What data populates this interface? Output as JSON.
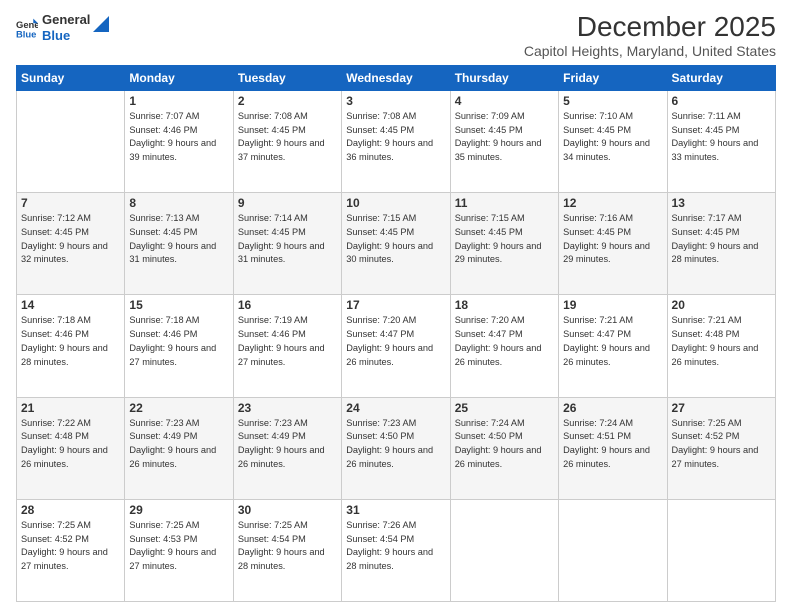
{
  "logo": {
    "line1": "General",
    "line2": "Blue"
  },
  "title": "December 2025",
  "subtitle": "Capitol Heights, Maryland, United States",
  "days_header": [
    "Sunday",
    "Monday",
    "Tuesday",
    "Wednesday",
    "Thursday",
    "Friday",
    "Saturday"
  ],
  "weeks": [
    [
      {
        "num": "",
        "sunrise": "",
        "sunset": "",
        "daylight": ""
      },
      {
        "num": "1",
        "sunrise": "Sunrise: 7:07 AM",
        "sunset": "Sunset: 4:46 PM",
        "daylight": "Daylight: 9 hours and 39 minutes."
      },
      {
        "num": "2",
        "sunrise": "Sunrise: 7:08 AM",
        "sunset": "Sunset: 4:45 PM",
        "daylight": "Daylight: 9 hours and 37 minutes."
      },
      {
        "num": "3",
        "sunrise": "Sunrise: 7:08 AM",
        "sunset": "Sunset: 4:45 PM",
        "daylight": "Daylight: 9 hours and 36 minutes."
      },
      {
        "num": "4",
        "sunrise": "Sunrise: 7:09 AM",
        "sunset": "Sunset: 4:45 PM",
        "daylight": "Daylight: 9 hours and 35 minutes."
      },
      {
        "num": "5",
        "sunrise": "Sunrise: 7:10 AM",
        "sunset": "Sunset: 4:45 PM",
        "daylight": "Daylight: 9 hours and 34 minutes."
      },
      {
        "num": "6",
        "sunrise": "Sunrise: 7:11 AM",
        "sunset": "Sunset: 4:45 PM",
        "daylight": "Daylight: 9 hours and 33 minutes."
      }
    ],
    [
      {
        "num": "7",
        "sunrise": "Sunrise: 7:12 AM",
        "sunset": "Sunset: 4:45 PM",
        "daylight": "Daylight: 9 hours and 32 minutes."
      },
      {
        "num": "8",
        "sunrise": "Sunrise: 7:13 AM",
        "sunset": "Sunset: 4:45 PM",
        "daylight": "Daylight: 9 hours and 31 minutes."
      },
      {
        "num": "9",
        "sunrise": "Sunrise: 7:14 AM",
        "sunset": "Sunset: 4:45 PM",
        "daylight": "Daylight: 9 hours and 31 minutes."
      },
      {
        "num": "10",
        "sunrise": "Sunrise: 7:15 AM",
        "sunset": "Sunset: 4:45 PM",
        "daylight": "Daylight: 9 hours and 30 minutes."
      },
      {
        "num": "11",
        "sunrise": "Sunrise: 7:15 AM",
        "sunset": "Sunset: 4:45 PM",
        "daylight": "Daylight: 9 hours and 29 minutes."
      },
      {
        "num": "12",
        "sunrise": "Sunrise: 7:16 AM",
        "sunset": "Sunset: 4:45 PM",
        "daylight": "Daylight: 9 hours and 29 minutes."
      },
      {
        "num": "13",
        "sunrise": "Sunrise: 7:17 AM",
        "sunset": "Sunset: 4:45 PM",
        "daylight": "Daylight: 9 hours and 28 minutes."
      }
    ],
    [
      {
        "num": "14",
        "sunrise": "Sunrise: 7:18 AM",
        "sunset": "Sunset: 4:46 PM",
        "daylight": "Daylight: 9 hours and 28 minutes."
      },
      {
        "num": "15",
        "sunrise": "Sunrise: 7:18 AM",
        "sunset": "Sunset: 4:46 PM",
        "daylight": "Daylight: 9 hours and 27 minutes."
      },
      {
        "num": "16",
        "sunrise": "Sunrise: 7:19 AM",
        "sunset": "Sunset: 4:46 PM",
        "daylight": "Daylight: 9 hours and 27 minutes."
      },
      {
        "num": "17",
        "sunrise": "Sunrise: 7:20 AM",
        "sunset": "Sunset: 4:47 PM",
        "daylight": "Daylight: 9 hours and 26 minutes."
      },
      {
        "num": "18",
        "sunrise": "Sunrise: 7:20 AM",
        "sunset": "Sunset: 4:47 PM",
        "daylight": "Daylight: 9 hours and 26 minutes."
      },
      {
        "num": "19",
        "sunrise": "Sunrise: 7:21 AM",
        "sunset": "Sunset: 4:47 PM",
        "daylight": "Daylight: 9 hours and 26 minutes."
      },
      {
        "num": "20",
        "sunrise": "Sunrise: 7:21 AM",
        "sunset": "Sunset: 4:48 PM",
        "daylight": "Daylight: 9 hours and 26 minutes."
      }
    ],
    [
      {
        "num": "21",
        "sunrise": "Sunrise: 7:22 AM",
        "sunset": "Sunset: 4:48 PM",
        "daylight": "Daylight: 9 hours and 26 minutes."
      },
      {
        "num": "22",
        "sunrise": "Sunrise: 7:23 AM",
        "sunset": "Sunset: 4:49 PM",
        "daylight": "Daylight: 9 hours and 26 minutes."
      },
      {
        "num": "23",
        "sunrise": "Sunrise: 7:23 AM",
        "sunset": "Sunset: 4:49 PM",
        "daylight": "Daylight: 9 hours and 26 minutes."
      },
      {
        "num": "24",
        "sunrise": "Sunrise: 7:23 AM",
        "sunset": "Sunset: 4:50 PM",
        "daylight": "Daylight: 9 hours and 26 minutes."
      },
      {
        "num": "25",
        "sunrise": "Sunrise: 7:24 AM",
        "sunset": "Sunset: 4:50 PM",
        "daylight": "Daylight: 9 hours and 26 minutes."
      },
      {
        "num": "26",
        "sunrise": "Sunrise: 7:24 AM",
        "sunset": "Sunset: 4:51 PM",
        "daylight": "Daylight: 9 hours and 26 minutes."
      },
      {
        "num": "27",
        "sunrise": "Sunrise: 7:25 AM",
        "sunset": "Sunset: 4:52 PM",
        "daylight": "Daylight: 9 hours and 27 minutes."
      }
    ],
    [
      {
        "num": "28",
        "sunrise": "Sunrise: 7:25 AM",
        "sunset": "Sunset: 4:52 PM",
        "daylight": "Daylight: 9 hours and 27 minutes."
      },
      {
        "num": "29",
        "sunrise": "Sunrise: 7:25 AM",
        "sunset": "Sunset: 4:53 PM",
        "daylight": "Daylight: 9 hours and 27 minutes."
      },
      {
        "num": "30",
        "sunrise": "Sunrise: 7:25 AM",
        "sunset": "Sunset: 4:54 PM",
        "daylight": "Daylight: 9 hours and 28 minutes."
      },
      {
        "num": "31",
        "sunrise": "Sunrise: 7:26 AM",
        "sunset": "Sunset: 4:54 PM",
        "daylight": "Daylight: 9 hours and 28 minutes."
      },
      {
        "num": "",
        "sunrise": "",
        "sunset": "",
        "daylight": ""
      },
      {
        "num": "",
        "sunrise": "",
        "sunset": "",
        "daylight": ""
      },
      {
        "num": "",
        "sunrise": "",
        "sunset": "",
        "daylight": ""
      }
    ]
  ]
}
